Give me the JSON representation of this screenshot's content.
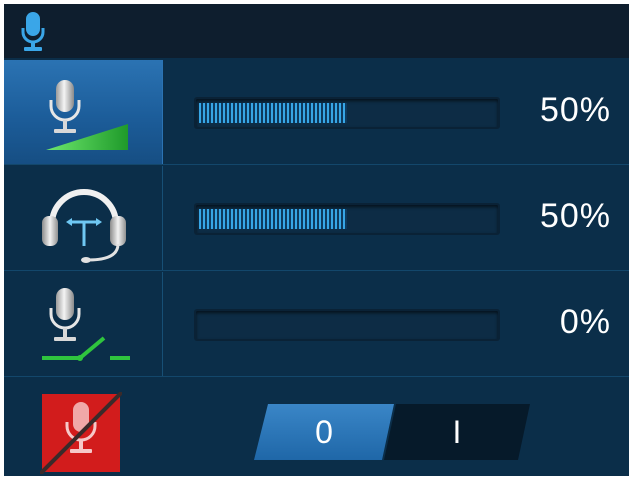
{
  "title_bar": {
    "icon": "microphone-icon"
  },
  "rows": [
    {
      "icon": "microphone-gain-icon",
      "percent": "50%",
      "level": 0.5,
      "selected": true
    },
    {
      "icon": "headset-icon",
      "percent": "50%",
      "level": 0.5,
      "selected": false
    },
    {
      "icon": "microphone-switch-icon",
      "percent": "0%",
      "level": 0.0,
      "selected": false
    }
  ],
  "mute_row": {
    "icon": "microphone-muted-icon",
    "toggle": {
      "off_label": "0",
      "on_label": "I",
      "selected": "off"
    }
  },
  "colors": {
    "accent": "#2b73b3",
    "level_fill": "#37a6e6",
    "green": "#2fc43e",
    "mute_red": "#d21c1c"
  }
}
